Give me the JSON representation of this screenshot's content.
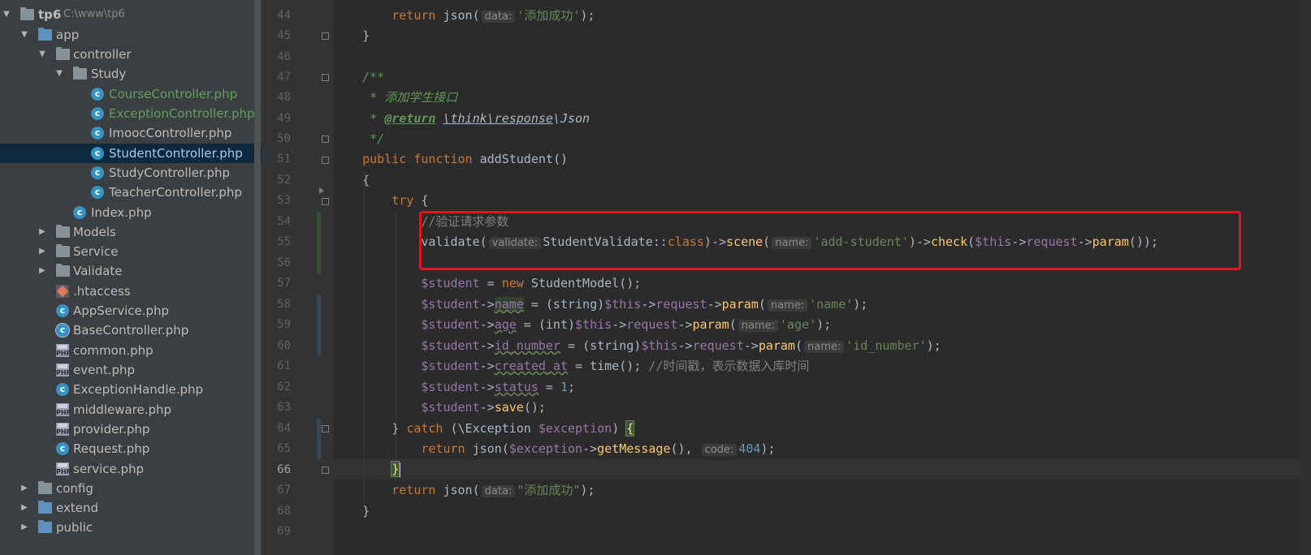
{
  "tree": {
    "root_name": "tp6",
    "root_path": "C:\\www\\tp6",
    "items": [
      {
        "label": "app"
      },
      {
        "label": "controller"
      },
      {
        "label": "Study"
      },
      {
        "label": "CourseController.php"
      },
      {
        "label": "ExceptionController.php"
      },
      {
        "label": "ImoocController.php"
      },
      {
        "label": "StudentController.php"
      },
      {
        "label": "StudyController.php"
      },
      {
        "label": "TeacherController.php"
      },
      {
        "label": "Index.php"
      },
      {
        "label": "Models"
      },
      {
        "label": "Service"
      },
      {
        "label": "Validate"
      },
      {
        "label": ".htaccess"
      },
      {
        "label": "AppService.php"
      },
      {
        "label": "BaseController.php"
      },
      {
        "label": "common.php"
      },
      {
        "label": "event.php"
      },
      {
        "label": "ExceptionHandle.php"
      },
      {
        "label": "middleware.php"
      },
      {
        "label": "provider.php"
      },
      {
        "label": "Request.php"
      },
      {
        "label": "service.php"
      },
      {
        "label": "config"
      },
      {
        "label": "extend"
      },
      {
        "label": "public"
      }
    ]
  },
  "editor": {
    "current_line": "66",
    "line_numbers": [
      "44",
      "45",
      "46",
      "47",
      "48",
      "49",
      "50",
      "51",
      "52",
      "53",
      "54",
      "55",
      "56",
      "57",
      "58",
      "59",
      "60",
      "61",
      "62",
      "63",
      "64",
      "65",
      "66",
      "67",
      "68",
      "69"
    ],
    "tokens": {
      "return": "return",
      "json": "json(",
      "hint_data": "data:",
      "str_success_single": "'添加成功'",
      "str_success_double": "\"添加成功\"",
      "close_paren_semi": ");",
      "close_brace": "}",
      "open_brace": "{",
      "doc_open": "/**",
      "doc_star": "*",
      "doc_title": "添加学生接口",
      "doc_return_tag": "@return",
      "doc_return_ns1": "\\think\\response",
      "doc_return_ns2": "\\Json",
      "doc_close": "*/",
      "kw_public": "public",
      "kw_function": "function",
      "fn_addStudent": "addStudent",
      "empty_parens": "()",
      "kw_try": "try",
      "comment_validate": "//验证请求参数",
      "validate_call": "validate(",
      "hint_validate": "validate:",
      "student_validate": "StudentValidate::",
      "kw_class": "class",
      "arrow_scene": ")->",
      "fn_scene": "scene",
      "hint_name": "name:",
      "str_add_student": "'add-student'",
      "fn_check": "check",
      "var_this": "$this",
      "arrow": "->",
      "prop_request": "request",
      "fn_param": "param",
      "var_student": "$student",
      "assign": " = ",
      "kw_new": "new",
      "student_model": " StudentModel();",
      "prop_name": "name",
      "cast_string": "(string)",
      "cast_int": "(int)",
      "str_name": "'name'",
      "prop_age": "age",
      "str_age": "'age'",
      "prop_id_number": "id_number",
      "str_id_number": "'id_number'",
      "prop_created_at": "created_at",
      "time_call": " = time(); ",
      "comment_time": "//时间戳，表示数据入库时间",
      "prop_status": "status",
      "num_1": "1",
      "semi": ";",
      "fn_save": "save",
      "save_tail": "();",
      "kw_catch": "catch",
      "exception_class": "(\\Exception ",
      "var_exception": "$exception",
      "paren_close": ") ",
      "fn_getMessage": "getMessage",
      "paren_comma": "(), ",
      "hint_code": "code:",
      "num_404": "404"
    }
  }
}
